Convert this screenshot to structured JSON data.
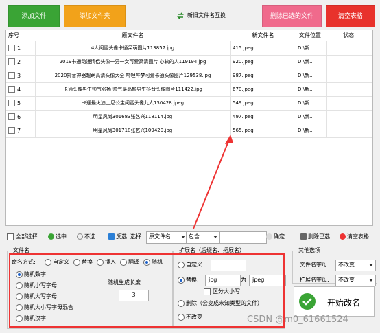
{
  "toolbar_top": {
    "add_file": "添加文件",
    "add_folder": "添加文件夹",
    "swap": "新旧文件名互换",
    "delete_selected": "删除已选的文件",
    "clear_table": "清空表格"
  },
  "table": {
    "headers": [
      "序号",
      "原文件名",
      "新文件名",
      "文件位置",
      "状态"
    ],
    "rows": [
      {
        "index": "1",
        "original": "4人闺蜜头像卡通呆萌图片113857.jpg",
        "new": "415.jpeg",
        "location": "D:\\新...",
        "status": ""
      },
      {
        "index": "2",
        "original": "2019卡通动漫情侣头像一男一女可爱高清图片 心软的人119194.jpg",
        "new": "920.jpeg",
        "location": "D:\\新...",
        "status": ""
      },
      {
        "index": "3",
        "original": "2020抖音神器超萌高清头像大全 哔哩哔梦可爱卡通头像图片129538.jpg",
        "new": "987.jpeg",
        "location": "D:\\新...",
        "status": ""
      },
      {
        "index": "4",
        "original": "卡通头像男生帅气张扬 帅气最高颜男生抖音头像图片111422.jpg",
        "new": "670.jpeg",
        "location": "D:\\新...",
        "status": ""
      },
      {
        "index": "5",
        "original": "卡通最火迪士尼公主闺蜜头像九人130428.jpeg",
        "new": "549.jpeg",
        "location": "D:\\新...",
        "status": ""
      },
      {
        "index": "6",
        "original": "明星风尚301683张艺兴118114.jpg",
        "new": "497.jpeg",
        "location": "D:\\新...",
        "status": ""
      },
      {
        "index": "7",
        "original": "明星风尚301718张艺兴109420.jpg",
        "new": "565.jpeg",
        "location": "D:\\新...",
        "status": ""
      }
    ]
  },
  "list_toolbar": {
    "select_all": "全部选择",
    "check": "选中",
    "uncheck": "不选",
    "invert": "反选",
    "select_label": "选择:",
    "field_value": "原文件名",
    "condition_value": "包含",
    "filter_value": "",
    "confirm": "确定",
    "delete_checked": "删除已选",
    "clear_table": "清空表格"
  },
  "filename_group": {
    "title": "文件名",
    "naming_label": "命名方式:",
    "naming_options": [
      "自定义",
      "替换",
      "插入",
      "翻译",
      "随机"
    ],
    "random_options": [
      "随机数字",
      "随机小写字母",
      "随机大写字母",
      "随机大小写字母混合",
      "随机汉字"
    ],
    "length_label": "随机生成长度:",
    "length_value": "3"
  },
  "extension_group": {
    "title": "扩展名（后缀名、拓展名）",
    "custom": "自定义:",
    "custom_value": "",
    "replace": "替换:",
    "replace_from": "jpg",
    "replace_as": "为",
    "replace_to": "jpeg",
    "case_sensitive": "区分大小写",
    "delete_ext": "删除（会变成未知类型的文件）",
    "no_change": "不改变"
  },
  "other_group": {
    "title": "其他选项",
    "name_case_label": "文件名字母:",
    "name_case_value": "不改变",
    "ext_case_label": "扩展名字母:",
    "ext_case_value": "不改变"
  },
  "start_button": "开始改名",
  "watermark": "CSDN @m0_61661524",
  "colors": {
    "highlight": "#e33333",
    "start_icon": "#3aa435"
  }
}
